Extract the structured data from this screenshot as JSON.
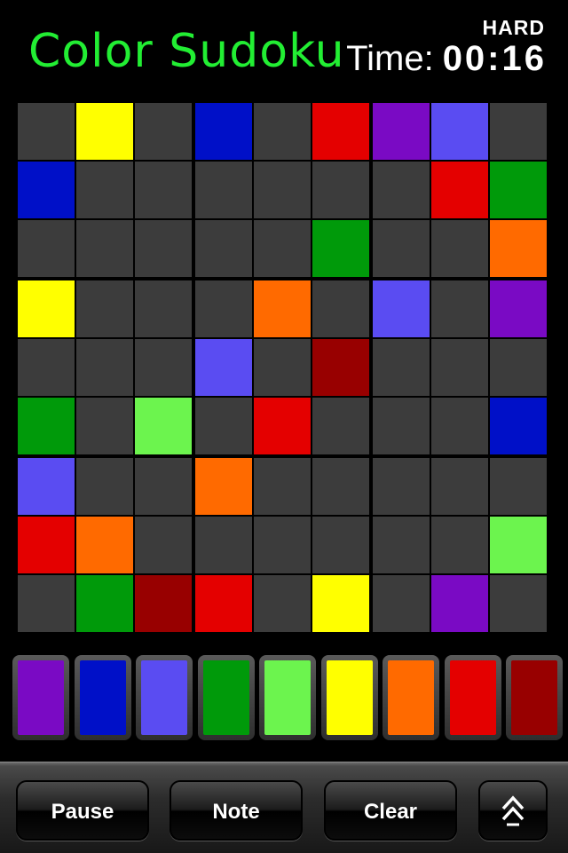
{
  "header": {
    "title": "Color Sudoku",
    "difficulty": "HARD",
    "time_label": "Time:",
    "time_value": "00:16"
  },
  "colors": {
    "empty": "#3c3c3c",
    "purple": "#7a0ac4",
    "blue": "#0010c8",
    "periwinkle": "#5a4cf2",
    "green": "#009a0a",
    "light_green": "#6cf44e",
    "yellow": "#ffff00",
    "orange": "#ff6a00",
    "red": "#e40000",
    "dark_red": "#980000"
  },
  "board": [
    [
      "empty",
      "yellow",
      "empty",
      "blue",
      "empty",
      "red",
      "purple",
      "periwinkle",
      "empty"
    ],
    [
      "blue",
      "empty",
      "empty",
      "empty",
      "empty",
      "empty",
      "empty",
      "red",
      "green"
    ],
    [
      "empty",
      "empty",
      "empty",
      "empty",
      "empty",
      "green",
      "empty",
      "empty",
      "orange"
    ],
    [
      "yellow",
      "empty",
      "empty",
      "empty",
      "orange",
      "empty",
      "periwinkle",
      "empty",
      "purple"
    ],
    [
      "empty",
      "empty",
      "empty",
      "periwinkle",
      "empty",
      "dark_red",
      "empty",
      "empty",
      "empty"
    ],
    [
      "green",
      "empty",
      "light_green",
      "empty",
      "red",
      "empty",
      "empty",
      "empty",
      "blue"
    ],
    [
      "periwinkle",
      "empty",
      "empty",
      "orange",
      "empty",
      "empty",
      "empty",
      "empty",
      "empty"
    ],
    [
      "red",
      "orange",
      "empty",
      "empty",
      "empty",
      "empty",
      "empty",
      "empty",
      "light_green"
    ],
    [
      "empty",
      "green",
      "dark_red",
      "red",
      "empty",
      "yellow",
      "empty",
      "purple",
      "empty"
    ]
  ],
  "palette": [
    "purple",
    "blue",
    "periwinkle",
    "green",
    "light_green",
    "yellow",
    "orange",
    "red",
    "dark_red"
  ],
  "toolbar": {
    "pause_label": "Pause",
    "note_label": "Note",
    "clear_label": "Clear",
    "up_icon": "double-chevron-up-icon"
  }
}
